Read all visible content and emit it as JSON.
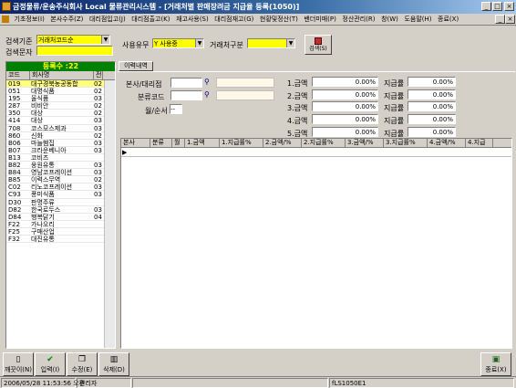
{
  "window": {
    "title": "금정물류/운송주식회사 Local 물류관리시스템 - [거래처별 판매장려금 지급율 등록(1050)]",
    "min_glyph": "_",
    "max_glyph": "□",
    "close_glyph": "×"
  },
  "menu": [
    "기초정보(I)",
    "본사수주(Z)",
    "대리점입고(J)",
    "대리점출고(K)",
    "재고사용(S)",
    "대리점재고(G)",
    "현황및정산(T)",
    "밴더미매(P)",
    "정산관리(R)",
    "창(W)",
    "도움말(H)",
    "종료(X)"
  ],
  "search": {
    "criteria_label": "검색기준",
    "criteria_value": "거래처코드순",
    "keyword_label": "검색문자",
    "keyword_value": "",
    "use_label": "사용유무",
    "use_value": "Y 사용중",
    "type_label": "거래처구분",
    "type_value": "",
    "search_button": "검색(S)"
  },
  "list": {
    "count_label": "등록수 :22",
    "headers": [
      "코드",
      "회사명",
      "전"
    ],
    "rows": [
      {
        "code": "019",
        "name": "대구경북농공동합",
        "extra": "02",
        "selected": true
      },
      {
        "code": "051",
        "name": "대명식품",
        "extra": "02"
      },
      {
        "code": "195",
        "name": "울식품",
        "extra": "03"
      },
      {
        "code": "287",
        "name": "비비안",
        "extra": "02"
      },
      {
        "code": "350",
        "name": "대상",
        "extra": "02"
      },
      {
        "code": "414",
        "name": "대상",
        "extra": "03"
      },
      {
        "code": "708",
        "name": "코스모스제과",
        "extra": "03"
      },
      {
        "code": "860",
        "name": "신화",
        "extra": "02"
      },
      {
        "code": "B06",
        "name": "마늘햄집",
        "extra": "03"
      },
      {
        "code": "B07",
        "name": "크라운베니아",
        "extra": "03"
      },
      {
        "code": "B13",
        "name": "코비즈",
        "extra": ""
      },
      {
        "code": "B82",
        "name": "웅원유통",
        "extra": "03"
      },
      {
        "code": "B84",
        "name": "영남코프레이션",
        "extra": "03"
      },
      {
        "code": "B85",
        "name": "이력스무역",
        "extra": "02"
      },
      {
        "code": "C02",
        "name": "리노코프레이션",
        "extra": "03"
      },
      {
        "code": "C93",
        "name": "풍미식품",
        "extra": "03"
      },
      {
        "code": "D30",
        "name": "판명주류",
        "extra": ""
      },
      {
        "code": "D82",
        "name": "한국로두스",
        "extra": "03"
      },
      {
        "code": "D84",
        "name": "행복닭기",
        "extra": "04"
      },
      {
        "code": "F22",
        "name": "가나오리",
        "extra": ""
      },
      {
        "code": "F25",
        "name": "구매산업",
        "extra": ""
      },
      {
        "code": "F32",
        "name": "대진유통",
        "extra": ""
      }
    ]
  },
  "detail": {
    "tab_label": "이력내역",
    "branch_label": "본사/대리점",
    "category_label": "분류코드",
    "month_label": "월/순서",
    "month_value": "--",
    "amounts": [
      {
        "amount_label": "1.금액",
        "amount_value": "0.00%",
        "rate_label": "지급률",
        "rate_value": "0.00%"
      },
      {
        "amount_label": "2.금액",
        "amount_value": "0.00%",
        "rate_label": "지급률",
        "rate_value": "0.00%"
      },
      {
        "amount_label": "3.금액",
        "amount_value": "0.00%",
        "rate_label": "지급률",
        "rate_value": "0.00%"
      },
      {
        "amount_label": "4.금액",
        "amount_value": "0.00%",
        "rate_label": "지급률",
        "rate_value": "0.00%"
      },
      {
        "amount_label": "5.금액",
        "amount_value": "0.00%",
        "rate_label": "지급률",
        "rate_value": "0.00%"
      }
    ]
  },
  "grid": {
    "headers": [
      "본사",
      "분류",
      "월",
      "1.금액",
      "1.지급률%",
      "2.금액/%",
      "2.지급률%",
      "3.금액/%",
      "3.지급률%",
      "4.금액/%",
      "4.지급"
    ],
    "row_marker": "▶"
  },
  "toolbar": {
    "clear": "깨끗이(N)",
    "input": "입력(I)",
    "edit": "수정(E)",
    "delete": "삭제(D)",
    "exit": "종료(X)"
  },
  "status": {
    "datetime": "2006/05/28 11:53:56 오후",
    "user": "관리자",
    "screen_id": "fLS1050E1"
  }
}
